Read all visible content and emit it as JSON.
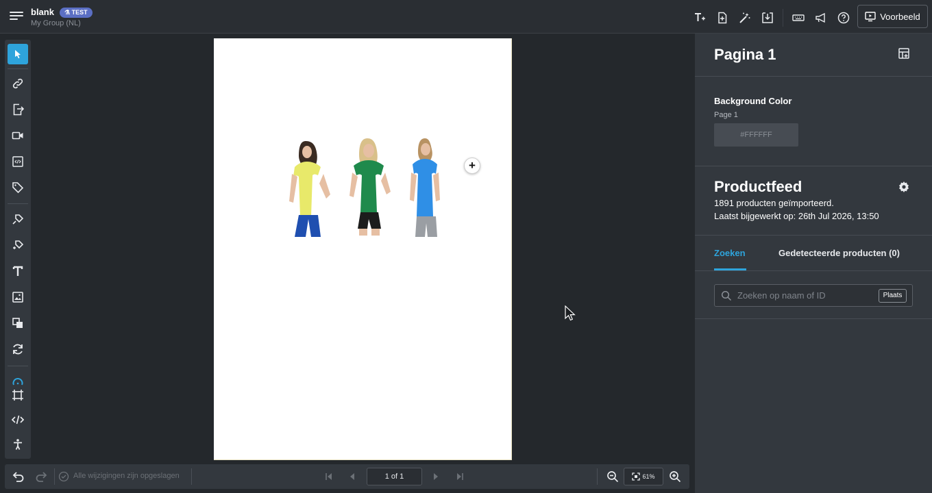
{
  "header": {
    "doc_title": "blank",
    "badge": "TEST",
    "group": "My Group (NL)",
    "preview_label": "Voorbeeld"
  },
  "canvas": {
    "page_color": "#FFFFFF",
    "add_label": "+"
  },
  "bottombar": {
    "saved_status": "Alle wijzigingen zijn opgeslagen",
    "page_indicator": "1 of 1",
    "zoom": "61%"
  },
  "panel": {
    "page_title": "Pagina 1",
    "bg_color_label": "Background Color",
    "bg_color_sub": "Page 1",
    "bg_color_value": "#FFFFFF",
    "feed_title": "Productfeed",
    "feed_count": "1891 producten geïmporteerd.",
    "feed_updated": "Laatst bijgewerkt op: 26th Jul 2026, 13:50",
    "tabs": [
      {
        "label": "Zoeken",
        "active": true
      },
      {
        "label": "Gedetecteerde producten (0)",
        "active": false
      }
    ],
    "search_placeholder": "Zoeken op naam of ID",
    "place_label": "Plaats"
  },
  "colors": {
    "accent": "#2ea4dc",
    "badge": "#5b6fc4",
    "shirt_yellow": "#e8e96a",
    "shirt_green": "#1f8a4c",
    "shirt_blue": "#2f8fe6"
  }
}
